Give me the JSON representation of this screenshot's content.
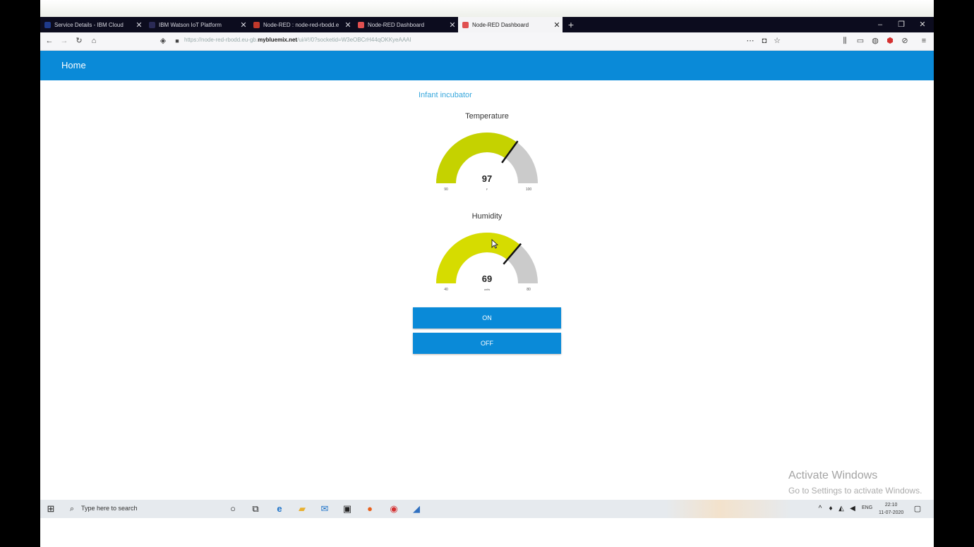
{
  "browser": {
    "tabs": [
      {
        "title": "Service Details - IBM Cloud",
        "active": false
      },
      {
        "title": "IBM Watson IoT Platform",
        "active": false
      },
      {
        "title": "Node-RED : node-red-rbodd.e",
        "active": false
      },
      {
        "title": "Node-RED Dashboard",
        "active": false
      },
      {
        "title": "Node-RED Dashboard",
        "active": true
      }
    ],
    "url_pre": "https://node-red-rbodd.eu-gb.",
    "url_domain": "mybluemix.net",
    "url_post": "/ui/#!/0?socketid=W3eOBCrH44qOKKyeAAAI"
  },
  "dashboard": {
    "title": "Home",
    "group_title": "Infant incubator",
    "gauges": [
      {
        "label": "Temperature",
        "value": 97,
        "min_label": "90",
        "max_label": "100",
        "units": "F",
        "min": 90,
        "max": 100,
        "color": "#c5d200"
      },
      {
        "label": "Humidity",
        "value": 69,
        "min_label": "40",
        "max_label": "80",
        "units": "units",
        "min": 40,
        "max": 80,
        "color": "#d6dc00"
      }
    ],
    "buttons": {
      "on": "ON",
      "off": "OFF"
    },
    "accent": "#0a8ad8"
  },
  "watermark": {
    "line1": "Activate Windows",
    "line2": "Go to Settings to activate Windows."
  },
  "taskbar": {
    "search_placeholder": "Type here to search",
    "lang": "ENG",
    "time": "22:10",
    "date": "11-07-2020"
  }
}
